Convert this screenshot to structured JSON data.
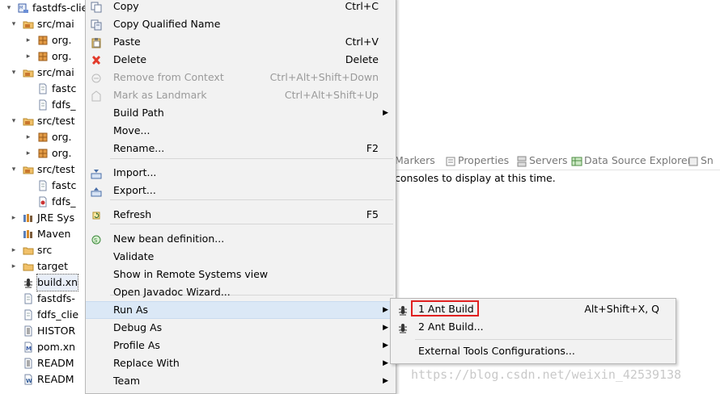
{
  "tree": {
    "items": [
      {
        "label": "fastdfs-clie",
        "icon": "maven-project-icon",
        "arrow": "▾",
        "indent": 0
      },
      {
        "label": "src/mai",
        "icon": "source-folder-icon",
        "arrow": "▾",
        "indent": 1
      },
      {
        "label": "org.",
        "icon": "package-icon",
        "arrow": "▸",
        "indent": 2
      },
      {
        "label": "org.",
        "icon": "package-icon",
        "arrow": "▸",
        "indent": 2
      },
      {
        "label": "src/mai",
        "icon": "source-folder-icon",
        "arrow": "▾",
        "indent": 1
      },
      {
        "label": "fastc",
        "icon": "file-icon",
        "arrow": "",
        "indent": 2
      },
      {
        "label": "fdfs_",
        "icon": "file-icon",
        "arrow": "",
        "indent": 2
      },
      {
        "label": "src/test",
        "icon": "source-folder-icon",
        "arrow": "▾",
        "indent": 1
      },
      {
        "label": "org.",
        "icon": "package-icon",
        "arrow": "▸",
        "indent": 2
      },
      {
        "label": "org.",
        "icon": "package-icon",
        "arrow": "▸",
        "indent": 2
      },
      {
        "label": "src/test",
        "icon": "source-folder-icon",
        "arrow": "▾",
        "indent": 1
      },
      {
        "label": "fastc",
        "icon": "file-icon",
        "arrow": "",
        "indent": 2
      },
      {
        "label": "fdfs_",
        "icon": "config-file-icon",
        "arrow": "",
        "indent": 2
      },
      {
        "label": "JRE Sys",
        "icon": "library-icon",
        "arrow": "▸",
        "indent": 1
      },
      {
        "label": "Maven",
        "icon": "library-icon",
        "arrow": "",
        "indent": 1
      },
      {
        "label": "src",
        "icon": "folder-icon",
        "arrow": "▸",
        "indent": 1
      },
      {
        "label": "target",
        "icon": "folder-icon",
        "arrow": "▸",
        "indent": 1
      },
      {
        "label": "build.xn",
        "icon": "ant-icon",
        "arrow": "",
        "indent": 1,
        "selected": true
      },
      {
        "label": "fastdfs-",
        "icon": "file-icon",
        "arrow": "",
        "indent": 1
      },
      {
        "label": "fdfs_clie",
        "icon": "file-icon",
        "arrow": "",
        "indent": 1
      },
      {
        "label": "HISTOR",
        "icon": "text-file-icon",
        "arrow": "",
        "indent": 1
      },
      {
        "label": "pom.xn",
        "icon": "pom-file-icon",
        "arrow": "",
        "indent": 1
      },
      {
        "label": "READM",
        "icon": "text-file-icon",
        "arrow": "",
        "indent": 1
      },
      {
        "label": "READM",
        "icon": "word-file-icon",
        "arrow": "",
        "indent": 1
      }
    ]
  },
  "menu": {
    "items": [
      {
        "label": "Copy",
        "shortcut": "Ctrl+C",
        "icon": "copy-icon"
      },
      {
        "label": "Copy Qualified Name",
        "shortcut": "",
        "icon": "copy-qualified-icon"
      },
      {
        "label": "Paste",
        "shortcut": "Ctrl+V",
        "icon": "paste-icon"
      },
      {
        "label": "Delete",
        "shortcut": "Delete",
        "icon": "delete-icon"
      },
      {
        "label": "Remove from Context",
        "shortcut": "Ctrl+Alt+Shift+Down",
        "icon": "remove-context-icon",
        "disabled": true
      },
      {
        "label": "Mark as Landmark",
        "shortcut": "Ctrl+Alt+Shift+Up",
        "icon": "landmark-icon",
        "disabled": true
      },
      {
        "label": "Build Path",
        "shortcut": "",
        "submenu": true
      },
      {
        "label": "Move...",
        "shortcut": ""
      },
      {
        "label": "Rename...",
        "shortcut": "F2"
      },
      {
        "label": "Import...",
        "shortcut": "",
        "icon": "import-icon"
      },
      {
        "label": "Export...",
        "shortcut": "",
        "icon": "export-icon"
      },
      {
        "label": "Refresh",
        "shortcut": "F5",
        "icon": "refresh-icon"
      },
      {
        "label": "New bean definition...",
        "shortcut": "",
        "icon": "bean-icon"
      },
      {
        "label": "Validate",
        "shortcut": ""
      },
      {
        "label": "Show in Remote Systems view",
        "shortcut": ""
      },
      {
        "label": "Open Javadoc Wizard...",
        "shortcut": ""
      },
      {
        "label": "Run As",
        "shortcut": "",
        "submenu": true,
        "highlighted": true
      },
      {
        "label": "Debug As",
        "shortcut": "",
        "submenu": true
      },
      {
        "label": "Profile As",
        "shortcut": "",
        "submenu": true
      },
      {
        "label": "Replace With",
        "shortcut": "",
        "submenu": true
      },
      {
        "label": "Team",
        "shortcut": "",
        "submenu": true
      }
    ]
  },
  "views_bar": {
    "tabs": [
      {
        "label": "Markers",
        "icon": ""
      },
      {
        "label": "Properties",
        "icon": "properties-icon"
      },
      {
        "label": "Servers",
        "icon": "servers-icon"
      },
      {
        "label": "Data Source Explorer",
        "icon": "data-source-icon"
      },
      {
        "label": "Sn",
        "icon": "snippets-icon"
      }
    ],
    "console_message": "consoles to display at this time."
  },
  "submenu": {
    "items": [
      {
        "label": "1 Ant Build",
        "shortcut": "Alt+Shift+X, Q",
        "icon": "ant-icon"
      },
      {
        "label": "2 Ant Build...",
        "shortcut": "",
        "icon": "ant-icon"
      },
      {
        "label": "External Tools Configurations...",
        "shortcut": ""
      }
    ],
    "annotation_color": "#e02020"
  },
  "watermark": "https://blog.csdn.net/weixin_42539138",
  "colors": {
    "menu_bg": "#f2f2f2",
    "highlight": "#dbe8f6",
    "disabled_text": "#9a9a9a"
  }
}
